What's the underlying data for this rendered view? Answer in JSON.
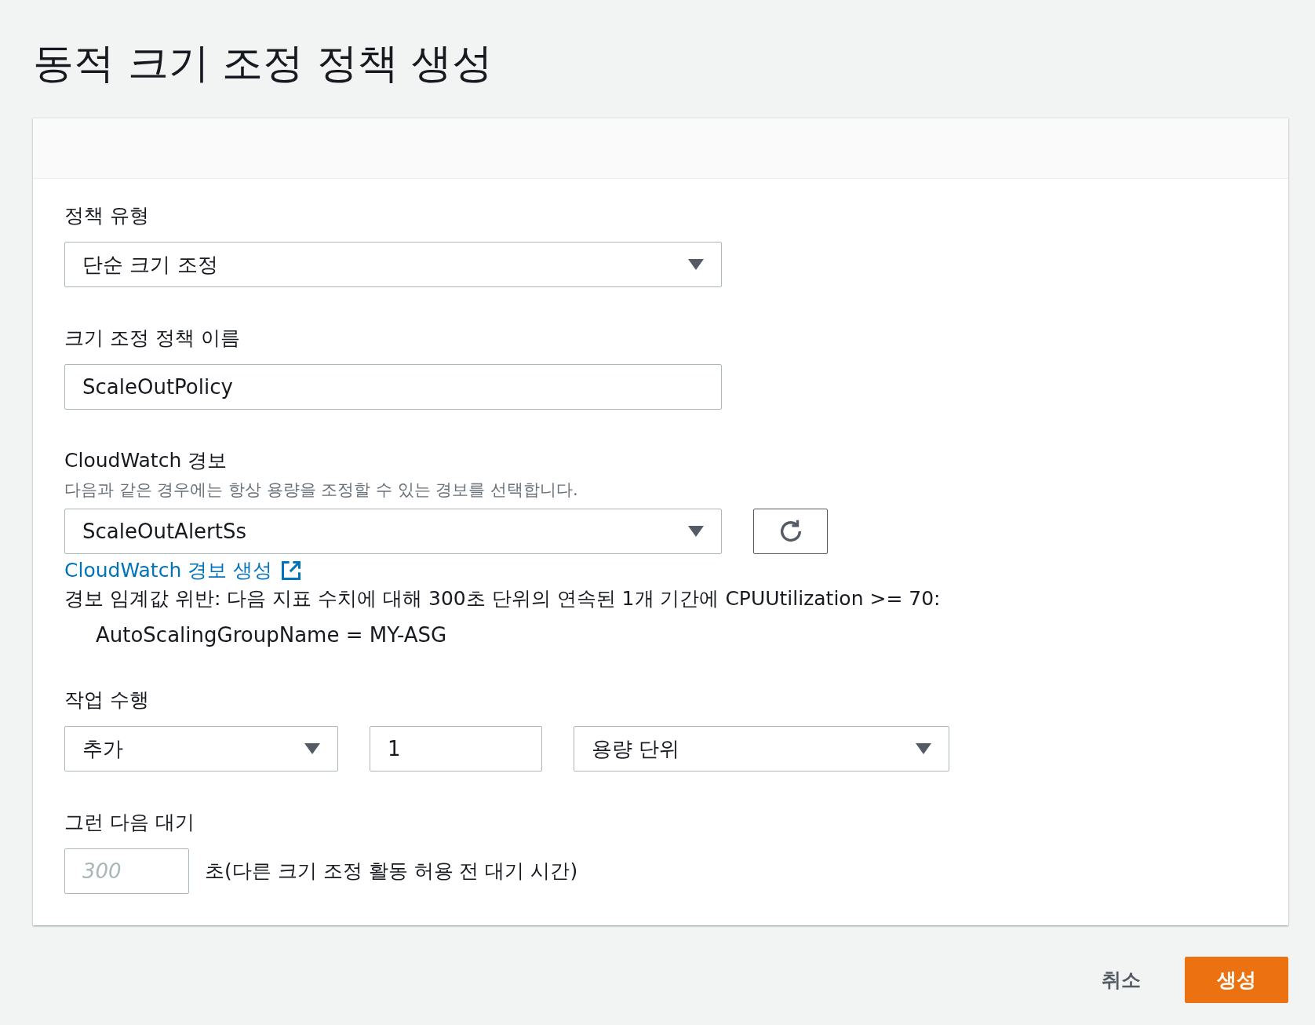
{
  "title": "동적 크기 조정 정책 생성",
  "form": {
    "policy_type": {
      "label": "정책 유형",
      "value": "단순 크기 조정"
    },
    "policy_name": {
      "label": "크기 조정 정책 이름",
      "value": "ScaleOutPolicy"
    },
    "alarm": {
      "label": "CloudWatch 경보",
      "hint": "다음과 같은 경우에는 항상 용량을 조정할 수 있는 경보를 선택합니다.",
      "value": "ScaleOutAlertSs",
      "create_link": "CloudWatch 경보 생성",
      "breach": "경보 임계값 위반: 다음 지표 수치에 대해 300초 단위의 연속된 1개 기간에 CPUUtilization >= 70:",
      "dimension": "AutoScalingGroupName = MY-ASG"
    },
    "action": {
      "label": "작업 수행",
      "operation": "추가",
      "amount": "1",
      "unit": "용량 단위"
    },
    "cooldown": {
      "label": "그런 다음 대기",
      "placeholder": "300",
      "suffix": "초(다른 크기 조정 활동 허용 전 대기 시간)"
    }
  },
  "buttons": [
    {
      "label": "취소",
      "kind": "link"
    },
    {
      "label": "생성",
      "kind": "primary"
    }
  ]
}
